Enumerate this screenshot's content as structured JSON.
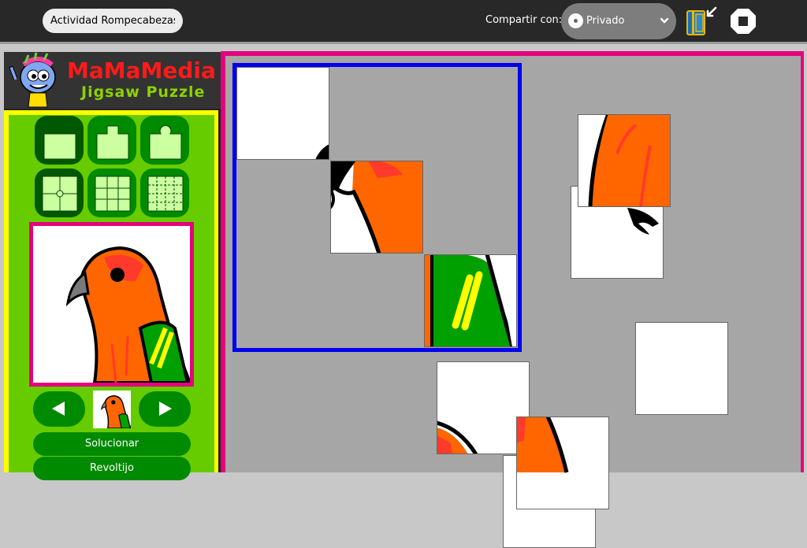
{
  "toolbar": {
    "activity_title": "Actividad Rompecabezas",
    "share_label": "Compartir con:",
    "share_value": "Privado",
    "journal_icon": "journal-icon",
    "stop_icon": "stop-icon"
  },
  "brand": {
    "title": "MaMaMedia",
    "subtitle": "Jigsaw Puzzle"
  },
  "controls": {
    "shape_buttons": [
      "cut-straight",
      "cut-square-tab",
      "cut-round-tab",
      "pieces-4",
      "pieces-9",
      "pieces-16"
    ],
    "solve_label": "Solucionar",
    "shuffle_label": "Revoltijo"
  },
  "colors": {
    "board_border": "#e5007d",
    "target_border": "#0000f0",
    "panel_green": "#66cc00",
    "panel_yellow": "#ffff00",
    "brand_red": "#ff1a1a",
    "brand_green": "#8bd200"
  }
}
